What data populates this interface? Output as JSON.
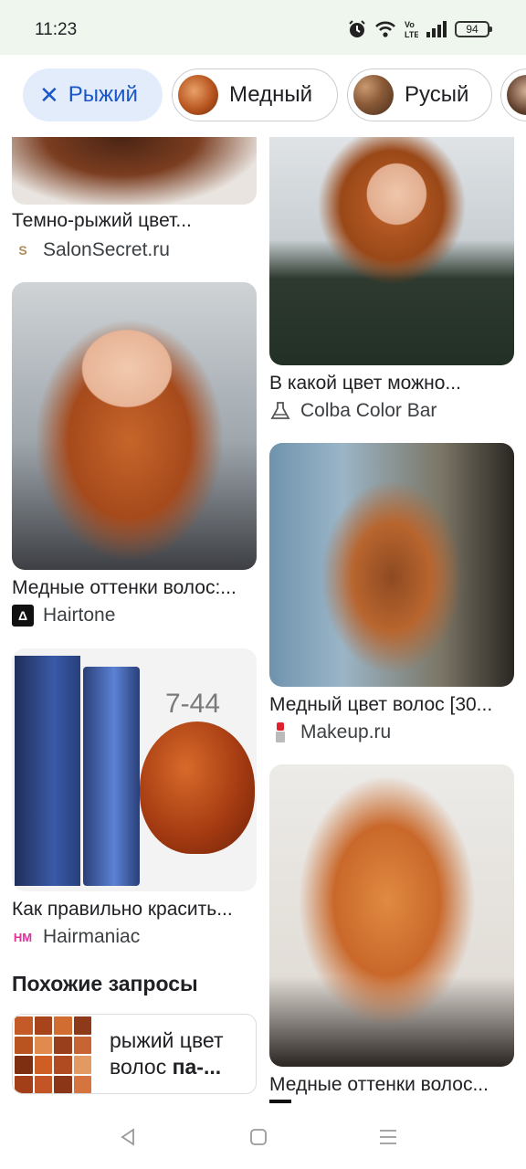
{
  "status_bar": {
    "time": "11:23",
    "battery": "94",
    "icons": [
      "alarm-icon",
      "wifi-icon",
      "volte-icon",
      "signal-icon",
      "battery-icon"
    ]
  },
  "chips": [
    {
      "label": "Рыжий",
      "selected": true,
      "icon": "close-icon"
    },
    {
      "label": "Медный",
      "selected": false
    },
    {
      "label": "Русый",
      "selected": false
    },
    {
      "label": "",
      "selected": false
    }
  ],
  "results": {
    "left": [
      {
        "title": "Темно-рыжий цвет...",
        "source": "SalonSecret.ru",
        "source_icon": "salonsecret-logo-icon"
      },
      {
        "title": "Медные оттенки волос:...",
        "source": "Hairtone",
        "source_icon": "hairtone-logo-icon"
      },
      {
        "title": "Как правильно красить...",
        "source": "Hairmaniac",
        "source_icon": "hairmaniac-logo-icon",
        "image_label": "7-44"
      }
    ],
    "right": [
      {
        "title": "В какой цвет можно...",
        "source": "Colba Color Bar",
        "source_icon": "colba-logo-icon"
      },
      {
        "title": "Медный цвет волос [30...",
        "source": "Makeup.ru",
        "source_icon": "makeup-logo-icon"
      },
      {
        "title": "Медные оттенки волос...",
        "source": "",
        "source_icon": "source-logo-icon"
      }
    ]
  },
  "related": {
    "heading": "Похожие запросы",
    "items": [
      {
        "text_plain": "рыжий цвет волос ",
        "text_bold": "па-..."
      }
    ]
  },
  "nav": [
    "back-icon",
    "home-icon",
    "recents-icon"
  ],
  "colors": {
    "status_bg": "#eef6ee",
    "chip_selected_bg": "#e3ecfb",
    "chip_selected_text": "#1a56c8",
    "text_primary": "#202124"
  }
}
